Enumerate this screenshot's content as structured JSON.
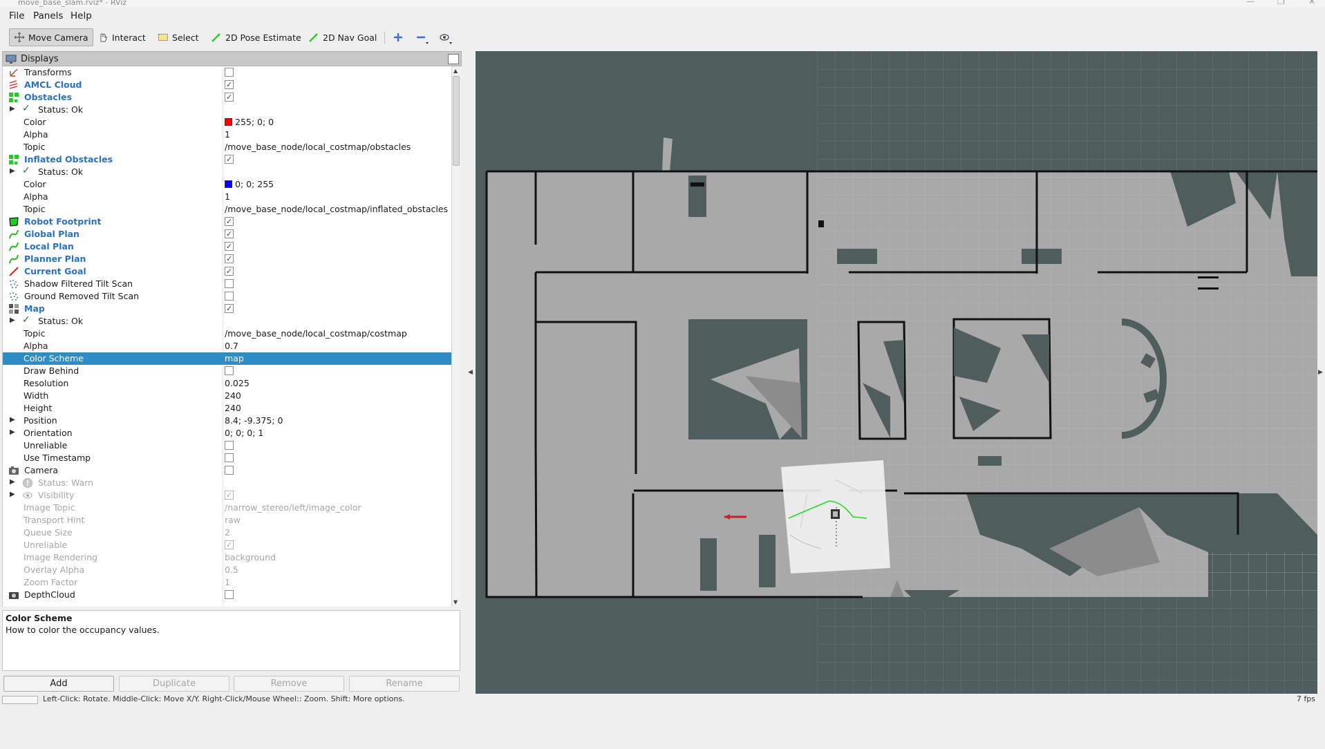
{
  "window": {
    "title": "move_base_slam.rviz* - RViz"
  },
  "menu": {
    "file": "File",
    "panels": "Panels",
    "help": "Help"
  },
  "toolbar": {
    "move_camera": "Move Camera",
    "interact": "Interact",
    "select": "Select",
    "pose_estimate": "2D Pose Estimate",
    "nav_goal": "2D Nav Goal"
  },
  "displays": {
    "title": "Displays",
    "rows": [
      {
        "label": "Transforms",
        "value": "",
        "check": ""
      },
      {
        "label": "AMCL Cloud",
        "value": "",
        "check": "✓"
      },
      {
        "label": "Obstacles",
        "value": "",
        "check": "✓"
      },
      {
        "label": "Status: Ok",
        "value": "",
        "check": ""
      },
      {
        "label": "Color",
        "value": "255; 0; 0",
        "check": ""
      },
      {
        "label": "Alpha",
        "value": "1",
        "check": ""
      },
      {
        "label": "Topic",
        "value": "/move_base_node/local_costmap/obstacles",
        "check": ""
      },
      {
        "label": "Inflated Obstacles",
        "value": "",
        "check": "✓"
      },
      {
        "label": "Status: Ok",
        "value": "",
        "check": ""
      },
      {
        "label": "Color",
        "value": "0; 0; 255",
        "check": ""
      },
      {
        "label": "Alpha",
        "value": "1",
        "check": ""
      },
      {
        "label": "Topic",
        "value": "/move_base_node/local_costmap/inflated_obstacles",
        "check": ""
      },
      {
        "label": "Robot Footprint",
        "value": "",
        "check": "✓"
      },
      {
        "label": "Global Plan",
        "value": "",
        "check": "✓"
      },
      {
        "label": "Local Plan",
        "value": "",
        "check": "✓"
      },
      {
        "label": "Planner Plan",
        "value": "",
        "check": "✓"
      },
      {
        "label": "Current Goal",
        "value": "",
        "check": "✓"
      },
      {
        "label": "Shadow Filtered Tilt Scan",
        "value": "",
        "check": ""
      },
      {
        "label": "Ground Removed Tilt Scan",
        "value": "",
        "check": ""
      },
      {
        "label": "Map",
        "value": "",
        "check": "✓"
      },
      {
        "label": "Status: Ok",
        "value": "",
        "check": ""
      },
      {
        "label": "Topic",
        "value": "/move_base_node/local_costmap/costmap",
        "check": ""
      },
      {
        "label": "Alpha",
        "value": "0.7",
        "check": ""
      },
      {
        "label": "Color Scheme",
        "value": "map",
        "check": ""
      },
      {
        "label": "Draw Behind",
        "value": "",
        "check": ""
      },
      {
        "label": "Resolution",
        "value": "0.025",
        "check": ""
      },
      {
        "label": "Width",
        "value": "240",
        "check": ""
      },
      {
        "label": "Height",
        "value": "240",
        "check": ""
      },
      {
        "label": "Position",
        "value": "8.4; -9.375; 0",
        "check": ""
      },
      {
        "label": "Orientation",
        "value": "0; 0; 0; 1",
        "check": ""
      },
      {
        "label": "Unreliable",
        "value": "",
        "check": ""
      },
      {
        "label": "Use Timestamp",
        "value": "",
        "check": ""
      },
      {
        "label": "Camera",
        "value": "",
        "check": ""
      },
      {
        "label": "Status: Warn",
        "value": "",
        "check": ""
      },
      {
        "label": "Visibility",
        "value": "",
        "check": "✓"
      },
      {
        "label": "Image Topic",
        "value": "/narrow_stereo/left/image_color",
        "check": ""
      },
      {
        "label": "Transport Hint",
        "value": "raw",
        "check": ""
      },
      {
        "label": "Queue Size",
        "value": "2",
        "check": ""
      },
      {
        "label": "Unreliable",
        "value": "",
        "check": "✓"
      },
      {
        "label": "Image Rendering",
        "value": "background",
        "check": ""
      },
      {
        "label": "Overlay Alpha",
        "value": "0.5",
        "check": ""
      },
      {
        "label": "Zoom Factor",
        "value": "1",
        "check": ""
      },
      {
        "label": "DepthCloud",
        "value": "",
        "check": ""
      }
    ]
  },
  "description": {
    "title": "Color Scheme",
    "body": "How to color the occupancy values."
  },
  "buttons": {
    "add": "Add",
    "duplicate": "Duplicate",
    "remove": "Remove",
    "rename": "Rename"
  },
  "colors": {
    "selection": "#308cc6",
    "bold_label": "#2a72c0",
    "viewport_bg": "#4f5e5c",
    "map_floor": "#a8a8a8"
  },
  "status": {
    "hint": "Left-Click: Rotate.  Middle-Click: Move X/Y.  Right-Click/Mouse Wheel:: Zoom.  Shift: More options.",
    "fps": "7 fps"
  }
}
